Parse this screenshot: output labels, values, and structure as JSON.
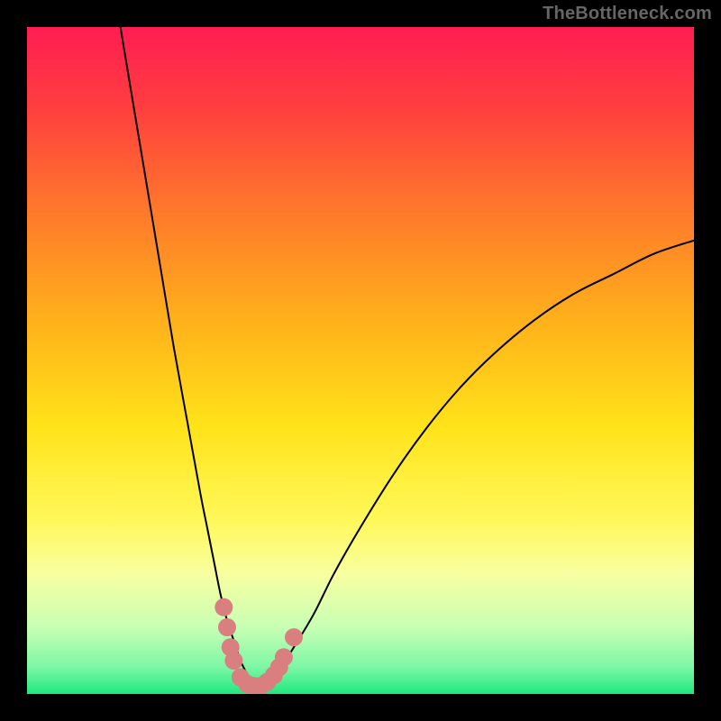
{
  "watermark": "TheBottleneck.com",
  "chart_data": {
    "type": "line",
    "title": "",
    "xlabel": "",
    "ylabel": "",
    "xlim": [
      0,
      100
    ],
    "ylim": [
      0,
      100
    ],
    "grid": false,
    "legend": false,
    "background_gradient": {
      "stops": [
        {
          "pct": 0,
          "color": "#ff1d52"
        },
        {
          "pct": 12,
          "color": "#ff3e3f"
        },
        {
          "pct": 28,
          "color": "#ff7a2a"
        },
        {
          "pct": 45,
          "color": "#ffb41a"
        },
        {
          "pct": 60,
          "color": "#ffe31a"
        },
        {
          "pct": 74,
          "color": "#fff85a"
        },
        {
          "pct": 82,
          "color": "#f8ffa0"
        },
        {
          "pct": 90,
          "color": "#c8ffb4"
        },
        {
          "pct": 96,
          "color": "#7cf7a6"
        },
        {
          "pct": 100,
          "color": "#1fe87f"
        }
      ]
    },
    "series": [
      {
        "name": "bottleneck-curve-left",
        "color": "#000000",
        "width": 2,
        "x": [
          14,
          16,
          18,
          20,
          22,
          24,
          26,
          27,
          28,
          29,
          30,
          31,
          32,
          33,
          34
        ],
        "y": [
          100,
          88,
          76,
          64,
          52,
          41,
          30,
          25,
          20,
          15,
          11,
          8,
          5,
          3,
          1.5
        ]
      },
      {
        "name": "bottleneck-curve-right",
        "color": "#000000",
        "width": 2,
        "x": [
          34,
          36,
          38,
          40,
          43,
          46,
          50,
          55,
          60,
          65,
          70,
          76,
          82,
          88,
          94,
          100
        ],
        "y": [
          1.5,
          2,
          4,
          7,
          12,
          18,
          25,
          33,
          40,
          46,
          51,
          56,
          60,
          63,
          66,
          68
        ]
      }
    ],
    "marker_points": {
      "name": "highlighted-range",
      "color": "#d97f7f",
      "radius": 10,
      "points": [
        {
          "x": 29.5,
          "y": 13
        },
        {
          "x": 30.0,
          "y": 10
        },
        {
          "x": 30.5,
          "y": 7
        },
        {
          "x": 31.0,
          "y": 5
        },
        {
          "x": 32.0,
          "y": 2.5
        },
        {
          "x": 33.0,
          "y": 1.5
        },
        {
          "x": 34.0,
          "y": 1.2
        },
        {
          "x": 35.0,
          "y": 1.2
        },
        {
          "x": 36.0,
          "y": 1.8
        },
        {
          "x": 37.0,
          "y": 2.8
        },
        {
          "x": 37.8,
          "y": 4.0
        },
        {
          "x": 38.5,
          "y": 5.5
        },
        {
          "x": 40.0,
          "y": 8.5
        }
      ]
    }
  }
}
